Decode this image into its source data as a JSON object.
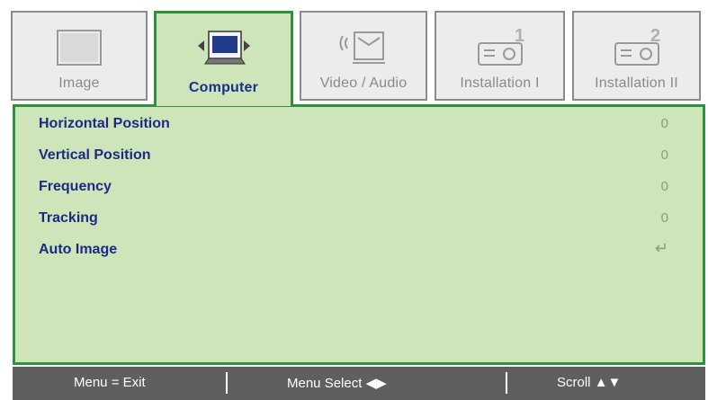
{
  "tabs": [
    {
      "label": "Image",
      "icon": "monitor-icon",
      "active": false
    },
    {
      "label": "Computer",
      "icon": "computer-icon",
      "active": true
    },
    {
      "label": "Video / Audio",
      "icon": "video-audio-icon",
      "active": false
    },
    {
      "label": "Installation I",
      "icon": "projector-1-icon",
      "active": false
    },
    {
      "label": "Installation II",
      "icon": "projector-2-icon",
      "active": false
    }
  ],
  "menu": {
    "items": [
      {
        "label": "Horizontal Position",
        "value": "0"
      },
      {
        "label": "Vertical Position",
        "value": "0"
      },
      {
        "label": "Frequency",
        "value": "0"
      },
      {
        "label": "Tracking",
        "value": "0"
      },
      {
        "label": "Auto Image",
        "value": "↵",
        "value_icon": "enter-icon"
      }
    ]
  },
  "footer": {
    "exit": "Menu = Exit",
    "menu_select": "Menu Select",
    "scroll": "Scroll"
  },
  "colors": {
    "panel_bg": "#cde5b8",
    "panel_border": "#2f9140",
    "label_text": "#1c2a85",
    "footer_bg": "#5f5f5f"
  }
}
